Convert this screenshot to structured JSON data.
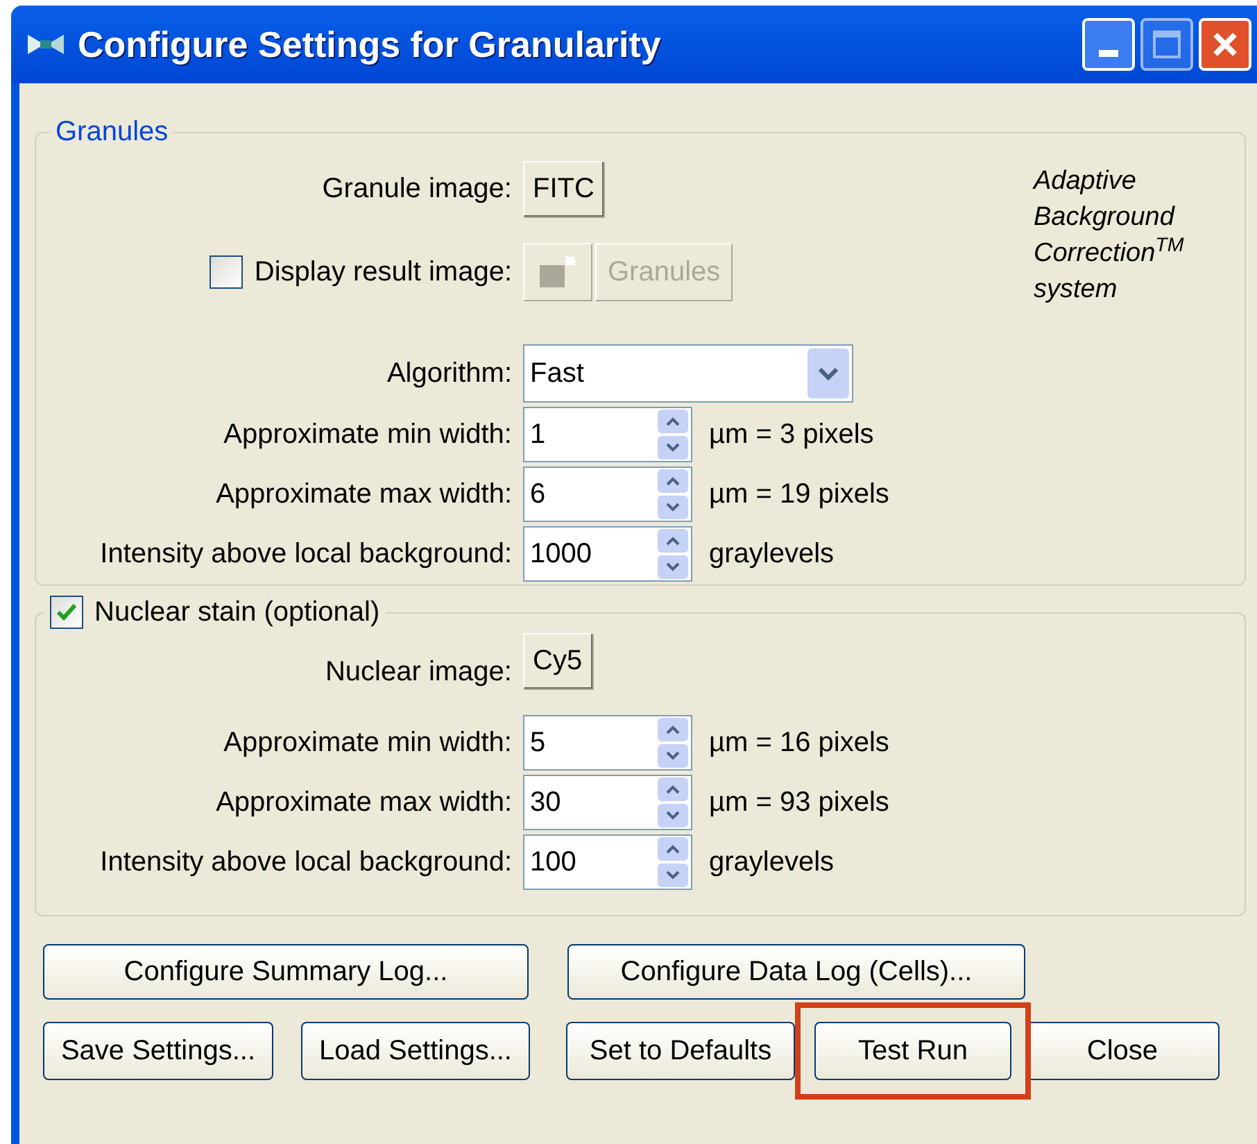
{
  "window": {
    "title": "Configure Settings for Granularity"
  },
  "granules": {
    "title": "Granules",
    "image_label": "Granule image:",
    "image_button": "FITC",
    "display_result": {
      "label": "Display result image:",
      "checked": false,
      "button": "Granules",
      "disabled": true
    },
    "note": "Adaptive Background Correction$^{TM}$ system",
    "algorithm": {
      "label": "Algorithm:",
      "value": "Fast"
    },
    "fields": [
      {
        "label": "Approximate min width:",
        "value": "1",
        "unit": "µm = 3 pixels"
      },
      {
        "label": "Approximate max width:",
        "value": "6",
        "unit": "µm = 19 pixels"
      },
      {
        "label": "Intensity above local background:",
        "value": "1000",
        "unit": "graylevels"
      }
    ]
  },
  "nuclear": {
    "title": "Nuclear stain (optional)",
    "checked": true,
    "image_label": "Nuclear image:",
    "image_button": "Cy5",
    "fields": [
      {
        "label": "Approximate min width:",
        "value": "5",
        "unit": "µm = 16 pixels"
      },
      {
        "label": "Approximate max width:",
        "value": "30",
        "unit": "µm = 93 pixels"
      },
      {
        "label": "Intensity above local background:",
        "value": "100",
        "unit": "graylevels"
      }
    ]
  },
  "buttons_row_1": [
    "Configure Summary Log...",
    "Configure Data Log (Cells)..."
  ],
  "buttons_row_2": [
    {
      "label": "Save Settings...",
      "highlighted": false
    },
    {
      "label": "Load Settings...",
      "highlighted": false
    },
    {
      "label": "Set to Defaults",
      "highlighted": false
    },
    {
      "label": "Test Run",
      "highlighted": true
    },
    {
      "label": "Close",
      "highlighted": false
    }
  ]
}
